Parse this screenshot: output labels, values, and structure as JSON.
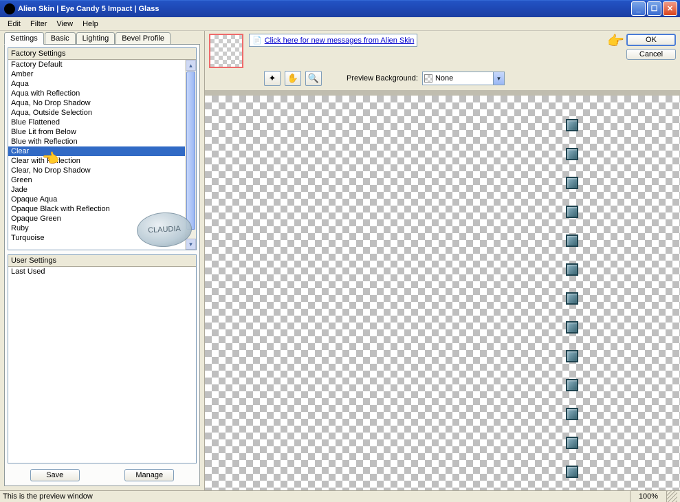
{
  "window": {
    "title": "Alien Skin  |  Eye Candy 5 Impact  |  Glass"
  },
  "menu": {
    "items": [
      "Edit",
      "Filter",
      "View",
      "Help"
    ]
  },
  "tabs": {
    "items": [
      "Settings",
      "Basic",
      "Lighting",
      "Bevel Profile"
    ],
    "active": 0
  },
  "factory": {
    "header": "Factory Settings",
    "items": [
      "Factory Default",
      "Amber",
      "Aqua",
      "Aqua with Reflection",
      "Aqua, No Drop Shadow",
      "Aqua, Outside Selection",
      "Blue Flattened",
      "Blue Lit from Below",
      "Blue with Reflection",
      "Clear",
      "Clear with Reflection",
      "Clear, No Drop Shadow",
      "Green",
      "Jade",
      "Opaque Aqua",
      "Opaque Black with Reflection",
      "Opaque Green",
      "Ruby",
      "Turquoise"
    ],
    "selected": "Clear"
  },
  "user": {
    "header": "User Settings",
    "items": [
      "Last Used"
    ]
  },
  "buttons": {
    "save": "Save",
    "manage": "Manage",
    "ok": "OK",
    "cancel": "Cancel"
  },
  "message": {
    "link": "Click here for new messages from Alien Skin"
  },
  "preview": {
    "bg_label": "Preview Background:",
    "bg_value": "None"
  },
  "watermark": "CLAUDIA",
  "status": {
    "text": "This is the preview window",
    "zoom": "100%"
  }
}
